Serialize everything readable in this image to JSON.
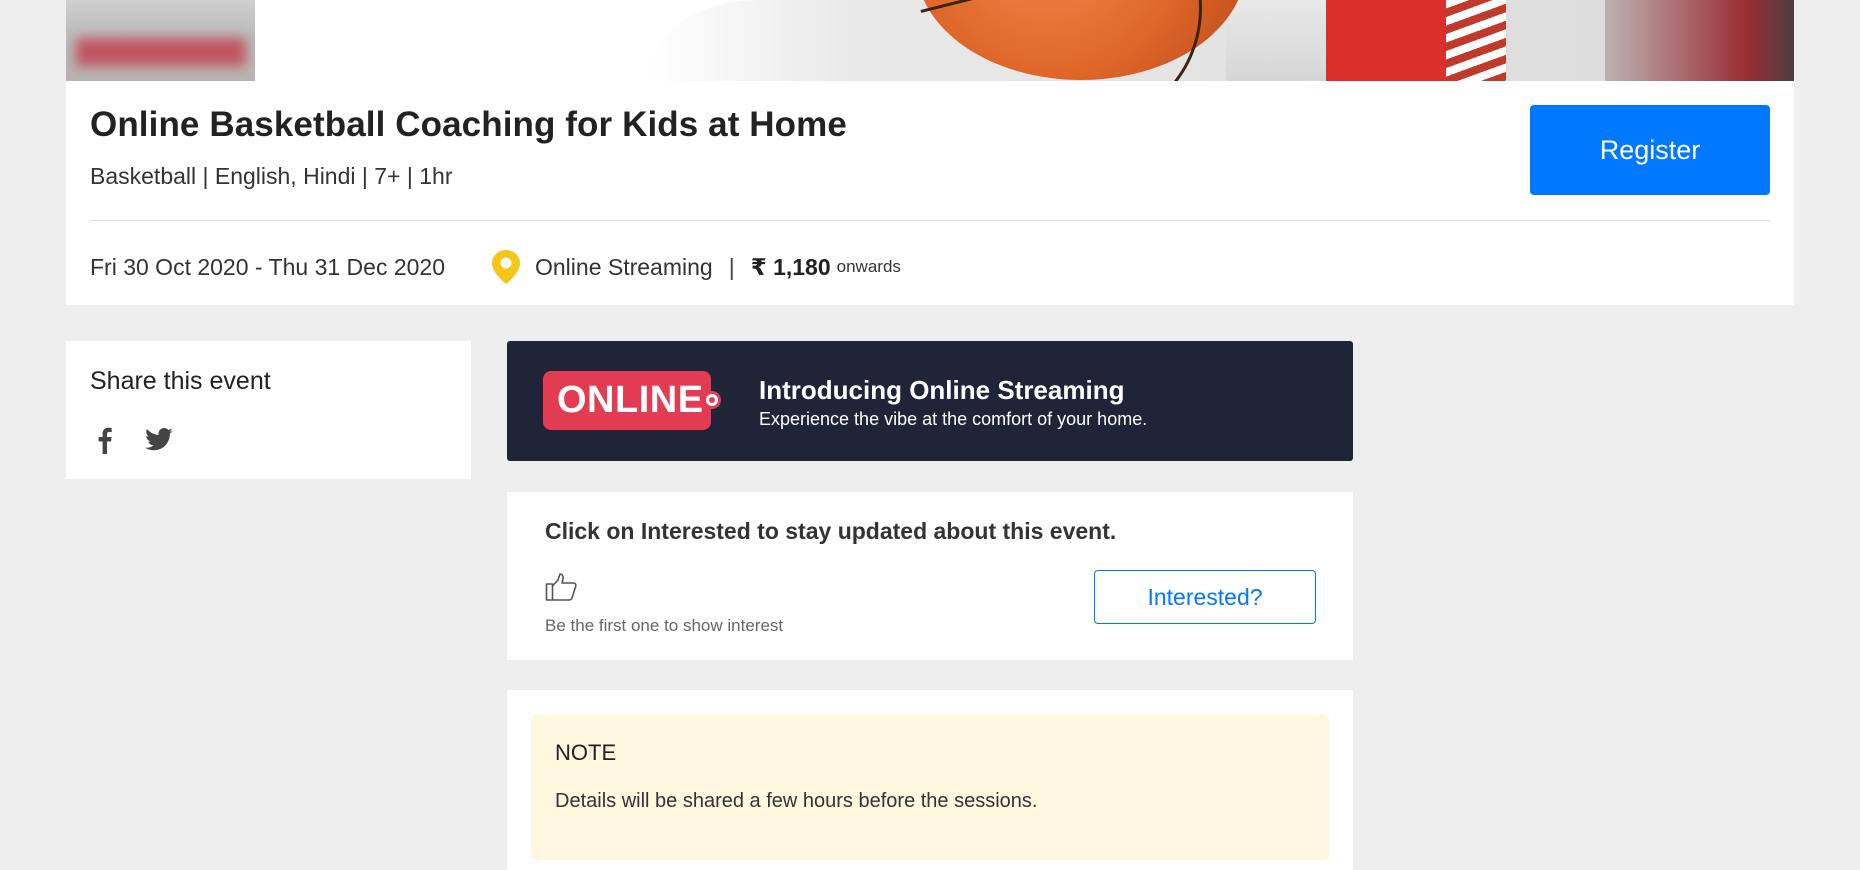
{
  "event": {
    "title": "Online Basketball Coaching for Kids at Home",
    "meta": "Basketball | English, Hindi | 7+ | 1hr",
    "register_label": "Register",
    "dates": "Fri 30 Oct 2020 - Thu 31 Dec 2020",
    "venue": "Online Streaming",
    "separator": "|",
    "price": "₹ 1,180",
    "price_suffix": "onwards"
  },
  "share": {
    "title": "Share this event",
    "icons": [
      "facebook-icon",
      "twitter-icon"
    ]
  },
  "online_banner": {
    "badge": "ONLINE",
    "title": "Introducing Online Streaming",
    "subtitle": "Experience the vibe at the comfort of your home."
  },
  "interest": {
    "title": "Click on Interested to stay updated about this event.",
    "subtitle": "Be the first one to show interest",
    "button_label": "Interested?"
  },
  "note": {
    "title": "NOTE",
    "text": "Details will be shared a few hours before the sessions."
  },
  "colors": {
    "primary": "#0078ff",
    "online_badge": "#e33b52",
    "online_banner_bg": "#1f2438",
    "pin": "#f5c518",
    "note_bg": "#fff7e0",
    "page_bg": "#eeeeee"
  }
}
